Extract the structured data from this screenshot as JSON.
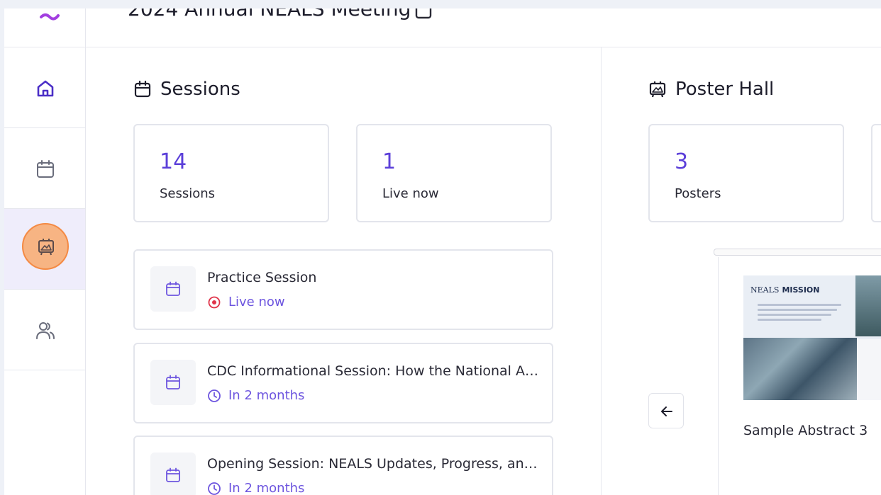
{
  "header": {
    "event_title": "2024 Annual NEALS Meeting"
  },
  "sidebar": {
    "items": [
      {
        "name": "home",
        "icon": "home-icon"
      },
      {
        "name": "sessions",
        "icon": "calendar-icon"
      },
      {
        "name": "poster-hall",
        "icon": "poster-icon"
      },
      {
        "name": "people",
        "icon": "users-icon"
      }
    ]
  },
  "sessions": {
    "heading": "Sessions",
    "stats": [
      {
        "value": "14",
        "label": "Sessions"
      },
      {
        "value": "1",
        "label": "Live now"
      }
    ],
    "list": [
      {
        "title": "Practice Session",
        "status": "Live now",
        "status_icon": "live-dot-icon"
      },
      {
        "title": "CDC Informational Session: How the National AL...",
        "status": "In 2 months",
        "status_icon": "clock-icon"
      },
      {
        "title": "Opening Session: NEALS Updates, Progress, and...",
        "status": "In 2 months",
        "status_icon": "clock-icon"
      }
    ]
  },
  "poster_hall": {
    "heading": "Poster Hall",
    "stats": [
      {
        "value": "3",
        "label": "Posters"
      }
    ],
    "poster": {
      "name": "Sample Abstract 3",
      "thumb_brand": "NEALS",
      "thumb_heading": "MISSION"
    }
  },
  "colors": {
    "accent": "#5b3fd9",
    "status": "#6d55df",
    "active_nav_bg": "#efedfb",
    "active_halo": "#f7b483"
  }
}
